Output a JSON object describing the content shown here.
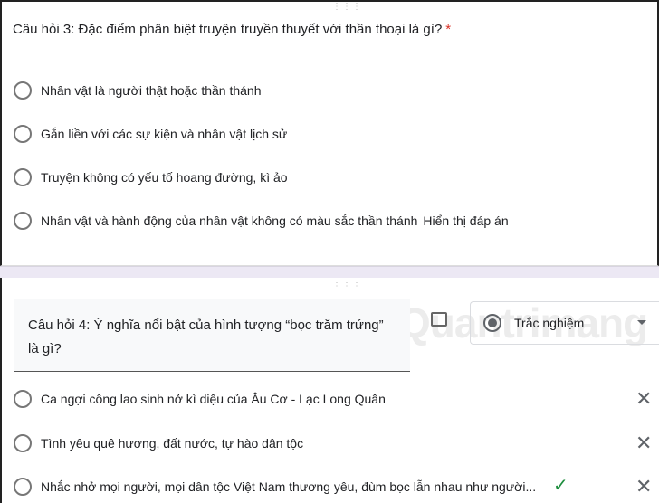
{
  "q3": {
    "title": "Câu hỏi 3: Đặc điểm phân biệt truyện truyền thuyết với thần thoại là gì?",
    "required_mark": "*",
    "options": [
      "Nhân vật là người thật hoặc thần thánh",
      "Gắn liền với các sự kiện và nhân vật lịch sử",
      "Truyện không có yếu tố hoang đường, kì ảo",
      "Nhân vật và hành động của nhân vật không có màu sắc thần thánh"
    ],
    "show_answer": "Hiển thị đáp án"
  },
  "q4": {
    "title": "Câu hỏi 4: Ý nghĩa nổi bật của hình tượng “bọc trăm trứng” là gì?",
    "type": "Trắc nghiệm",
    "options": [
      "Ca ngợi công lao sinh nở kì diệu của Âu Cơ - Lạc Long Quân",
      "Tình yêu quê hương, đất nước, tự hào dân tộc",
      "Nhắc nhở mọi người, mọi dân tộc Việt Nam thương yêu, đùm bọc lẫn nhau như người..."
    ]
  },
  "watermark": "Quantrimang"
}
